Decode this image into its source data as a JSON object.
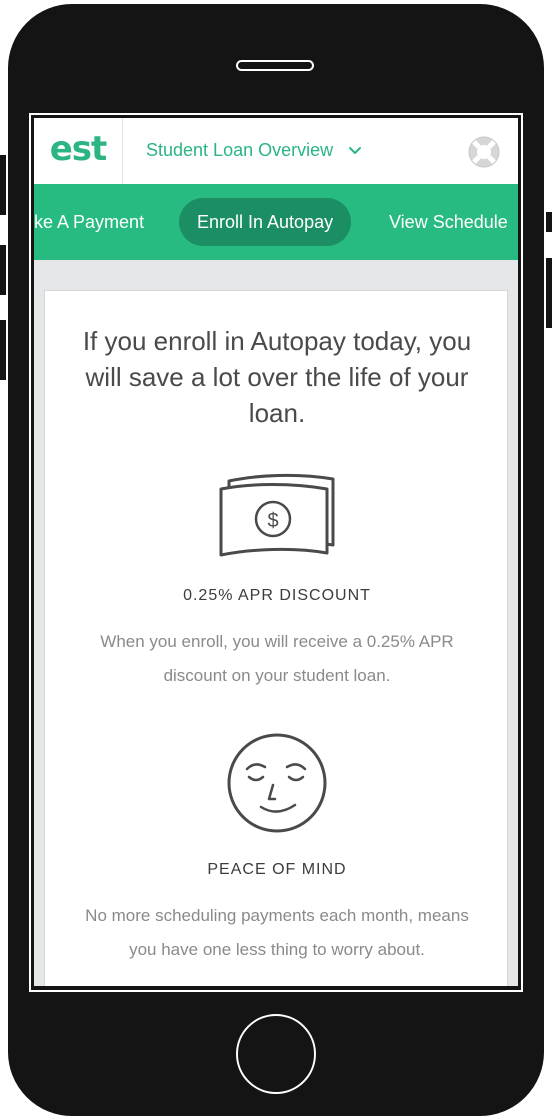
{
  "header": {
    "logo_text": "est",
    "title": "Student Loan Overview",
    "dropdown_icon": "chevron-down-icon",
    "help_icon": "lifebuoy-icon"
  },
  "tabs": [
    {
      "label": "ke A Payment"
    },
    {
      "label": "Enroll In Autopay",
      "active": true
    },
    {
      "label": "View Schedule"
    }
  ],
  "card": {
    "headline": "If you enroll in Autopay today, you will save a lot over the life of your loan.",
    "features": [
      {
        "icon": "money-bill-icon",
        "title": "0.25% APR DISCOUNT",
        "description": "When you enroll, you will receive a 0.25% APR discount on your student loan."
      },
      {
        "icon": "smiley-face-icon",
        "title": "PEACE OF MIND",
        "description": "No more scheduling payments each month, means you have one less thing to worry about."
      }
    ]
  },
  "colors": {
    "brand_green": "#2bb583",
    "tab_bar": "#27bb82",
    "tab_active": "#1b8e63",
    "phone_body": "#141414"
  }
}
